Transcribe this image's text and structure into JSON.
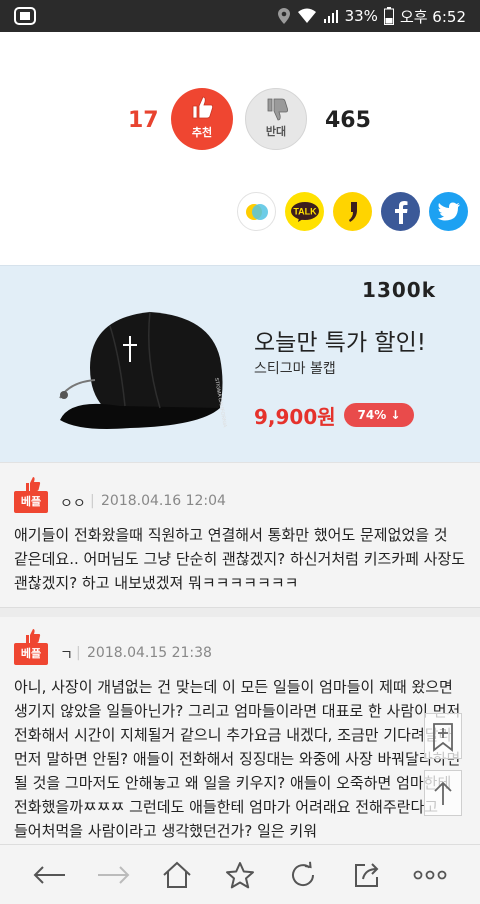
{
  "statusbar": {
    "battery_percent": "33%",
    "time": "오후 6:52"
  },
  "vote": {
    "up_count": "17",
    "up_label": "추천",
    "down_label": "반대",
    "down_count": "465"
  },
  "share": {
    "items": [
      "kakaostory-icon",
      "kakaotalk-icon",
      "kakao-icon",
      "facebook-icon",
      "twitter-icon"
    ],
    "talk_text": "TALK"
  },
  "ad": {
    "brand": "1300k",
    "title": "오늘만 특가 할인!",
    "product": "스티그마 볼캡",
    "price": "9,900원",
    "discount": "74% ↓"
  },
  "comments": [
    {
      "badge": "베플",
      "name": "ㅇㅇ",
      "date": "2018.04.16 12:04",
      "body": "애기들이 전화왔을때 직원하고 연결해서 통화만 했어도 문제없었을 것 같은데요.. 어머님도 그냥 단순히 괜찮겠지? 하신거처럼 키즈카페 사장도 괜찮겠지? 하고 내보냈겠져 뭐ㅋㅋㅋㅋㅋㅋㅋ"
    },
    {
      "badge": "베플",
      "name": "ㄱ",
      "date": "2018.04.15 21:38",
      "body": "아니, 사장이 개념없는 건 맞는데 이 모든 일들이 엄마들이 제때 왔으면 생기지 않았을 일들아닌가? 그리고 엄마들이라면 대표로 한 사람이 먼저 전화해서 시간이 지체될거 같으니 추가요금 내겠다, 조금만 기다려달라 먼저 말하면 안됨? 애들이 전화해서 징징대는 와중에 사장 바꿔달라하면 될 것을 그마저도 안해놓고 왜 일을 키우지? 애들이 오죽하면 엄마한테 전화했을까ㅉㅉㅉ 그런데도 애들한테 엄마가 어려래요 전해주란다고 들어처먹을 사람이라고 생각했던건가? 일은 키워"
    }
  ],
  "colors": {
    "accent": "#ef4631",
    "ad_bg": "#e2eef7"
  }
}
